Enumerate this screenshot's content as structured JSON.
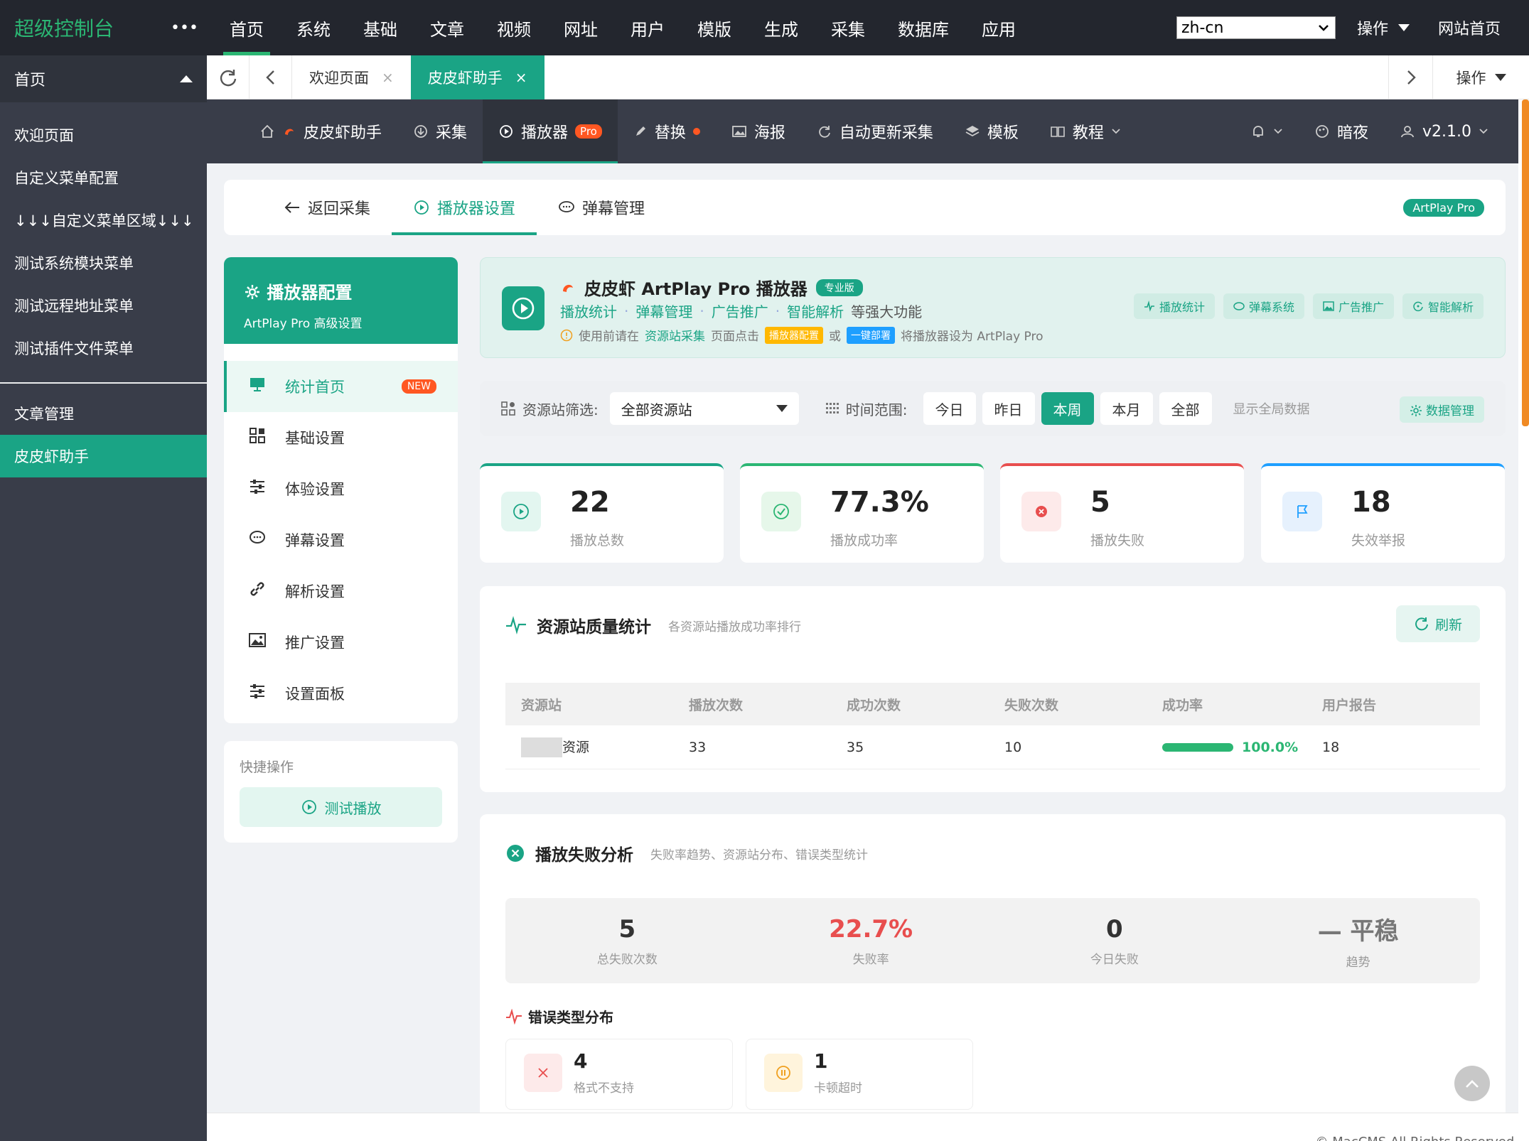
{
  "app": {
    "logo": "超级控制台",
    "more": "•••",
    "topnav": [
      "首页",
      "系统",
      "基础",
      "文章",
      "视频",
      "网址",
      "用户",
      "模版",
      "生成",
      "采集",
      "数据库",
      "应用"
    ],
    "lang_value": "zh-cn",
    "ops_label": "操作",
    "site_home": "网站首页"
  },
  "sidebar": {
    "head": "首页",
    "items": [
      "欢迎页面",
      "自定义菜单配置",
      "↓↓↓自定义菜单区域↓↓↓",
      "测试系统模块菜单",
      "测试远程地址菜单",
      "测试插件文件菜单"
    ],
    "items2": [
      "文章管理",
      "皮皮虾助手"
    ]
  },
  "tabbar": {
    "tabs": [
      "欢迎页面",
      "皮皮虾助手"
    ],
    "close": "×",
    "ops": "操作"
  },
  "subnav": {
    "items": [
      "皮皮虾助手",
      "采集",
      "播放器",
      "替换",
      "海报",
      "自动更新采集",
      "模板",
      "教程"
    ],
    "pro": "Pro",
    "dark": "暗夜",
    "version": "v2.1.0"
  },
  "toptabs": {
    "back": "返回采集",
    "player": "播放器设置",
    "danmaku": "弹幕管理",
    "badge": "ArtPlay Pro"
  },
  "config": {
    "title": "播放器配置",
    "subtitle": "ArtPlay Pro 高级设置",
    "menu": [
      "统计首页",
      "基础设置",
      "体验设置",
      "弹幕设置",
      "解析设置",
      "推广设置",
      "设置面板"
    ],
    "new_badge": "NEW",
    "quick_title": "快捷操作",
    "quick_btn": "测试播放"
  },
  "hero": {
    "title": "皮皮虾 ArtPlay Pro 播放器",
    "tag": "专业版",
    "links": [
      "播放统计",
      "弹幕管理",
      "广告推广",
      "智能解析"
    ],
    "links_sep": "·",
    "links_tail": "等强大功能",
    "note_prefix": "使用前请在",
    "note_link": "资源站采集",
    "note_mid": "页面点击",
    "note_tag1": "播放器配置",
    "note_or": "或",
    "note_tag2": "一键部署",
    "note_suffix": "将播放器设为 ArtPlay Pro",
    "buttons": [
      "播放统计",
      "弹幕系统",
      "广告推广",
      "智能解析"
    ]
  },
  "filter": {
    "label": "资源站筛选:",
    "select": "全部资源站",
    "range_label": "时间范围:",
    "ranges": [
      "今日",
      "昨日",
      "本周",
      "本月",
      "全部"
    ],
    "active_range": "本周",
    "global": "显示全局数据",
    "manage": "数据管理"
  },
  "stats": [
    {
      "value": "22",
      "label": "播放总数",
      "color": "#1aa485"
    },
    {
      "value": "77.3%",
      "label": "播放成功率",
      "color": "#2bb673"
    },
    {
      "value": "5",
      "label": "播放失败",
      "color": "#e84e4e"
    },
    {
      "value": "18",
      "label": "失效举报",
      "color": "#1e9fff"
    }
  ],
  "quality": {
    "title": "资源站质量统计",
    "subtitle": "各资源站播放成功率排行",
    "refresh": "刷新",
    "columns": [
      "资源站",
      "播放次数",
      "成功次数",
      "失败次数",
      "成功率",
      "用户报告"
    ],
    "rows": [
      {
        "site": "资源",
        "plays": "33",
        "success": "35",
        "fail": "10",
        "rate": "100.0%",
        "rate_fraction": 1.0,
        "reports": "18"
      }
    ]
  },
  "failure": {
    "title": "播放失败分析",
    "subtitle": "失败率趋势、资源站分布、错误类型统计",
    "summary": [
      {
        "value": "5",
        "label": "总失败次数"
      },
      {
        "value": "22.7%",
        "label": "失败率"
      },
      {
        "value": "0",
        "label": "今日失败"
      },
      {
        "value": "— 平稳",
        "label": "趋势"
      }
    ],
    "error_title": "错误类型分布",
    "errors": [
      {
        "value": "4",
        "label": "格式不支持"
      },
      {
        "value": "1",
        "label": "卡顿超时"
      }
    ]
  },
  "footer": "© MacCMS All Rights Reserved.",
  "colors": {
    "accent": "#1aa485",
    "topbar": "#23262e",
    "sidebar": "#393d49",
    "danger": "#e84e4e",
    "badge": "#ff5722"
  }
}
